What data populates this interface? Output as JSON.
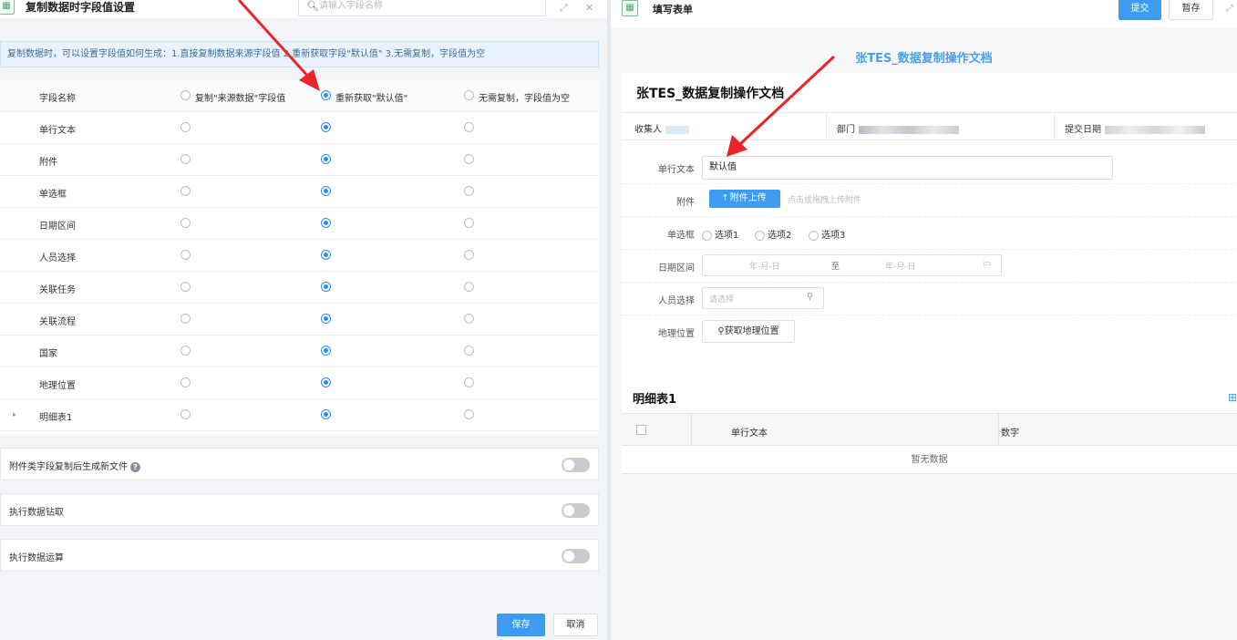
{
  "left": {
    "app_icon": "table-green-icon",
    "title": "复制数据时字段值设置",
    "search": {
      "placeholder": "请输入字段名称"
    },
    "notice": "复制数据时，可以设置字段值如何生成：1.直接复制数据来源字段值 2.重新获取字段\"默认值\" 3.无需复制，字段值为空",
    "table": {
      "header_name": "字段名称",
      "options": [
        "复制\"来源数据\"字段值",
        "重新获取\"默认值\"",
        "无需复制，字段值为空"
      ],
      "header_selected": 1,
      "rows": [
        {
          "name": "单行文本",
          "selected": 1
        },
        {
          "name": "附件",
          "selected": 1
        },
        {
          "name": "单选框",
          "selected": 1
        },
        {
          "name": "日期区间",
          "selected": 1
        },
        {
          "name": "人员选择",
          "selected": 1
        },
        {
          "name": "关联任务",
          "selected": 1
        },
        {
          "name": "关联流程",
          "selected": 1
        },
        {
          "name": "国家",
          "selected": 1
        },
        {
          "name": "地理位置",
          "selected": 1
        },
        {
          "name": "明细表1",
          "selected": 1,
          "expandable": true
        }
      ]
    },
    "toggles": [
      {
        "label": "附件类字段复制后生成新文件",
        "help": "?",
        "on": false
      },
      {
        "label": "执行数据钻取",
        "on": false
      },
      {
        "label": "执行数据运算",
        "on": false
      }
    ],
    "save_label": "保存",
    "cancel_label": "取消"
  },
  "right": {
    "app_icon": "table-green-icon",
    "title": "填写表单",
    "submit_label": "提交",
    "draft_label": "暂存",
    "doc_title": "张TES_数据复制操作文档",
    "form_title": "张TES_数据复制操作文档",
    "meta": {
      "collector_label": "收集人",
      "dept_label": "部门",
      "date_label": "提交日期"
    },
    "fields": {
      "text_label": "单行文本",
      "text_value": "默认值",
      "attach_label": "附件",
      "upload_label": "附件上传",
      "upload_hint": "点击或拖拽上传附件",
      "radio_label": "单选框",
      "radio_options": [
        "选项1",
        "选项2",
        "选项3"
      ],
      "date_label": "日期区间",
      "date_start": "年-月-日",
      "date_to": "至",
      "date_end": "年-月-日",
      "person_label": "人员选择",
      "person_placeholder": "请选择",
      "geo_label": "地理位置",
      "geo_button": "获取地理位置"
    },
    "subtable": {
      "title": "明细表1",
      "columns": [
        "单行文本",
        "数字"
      ],
      "empty": "暂无数据"
    }
  },
  "colors": {
    "accent": "#3d9cf0",
    "arrow": "#e8262a",
    "doc_title": "#4aa0e6"
  }
}
